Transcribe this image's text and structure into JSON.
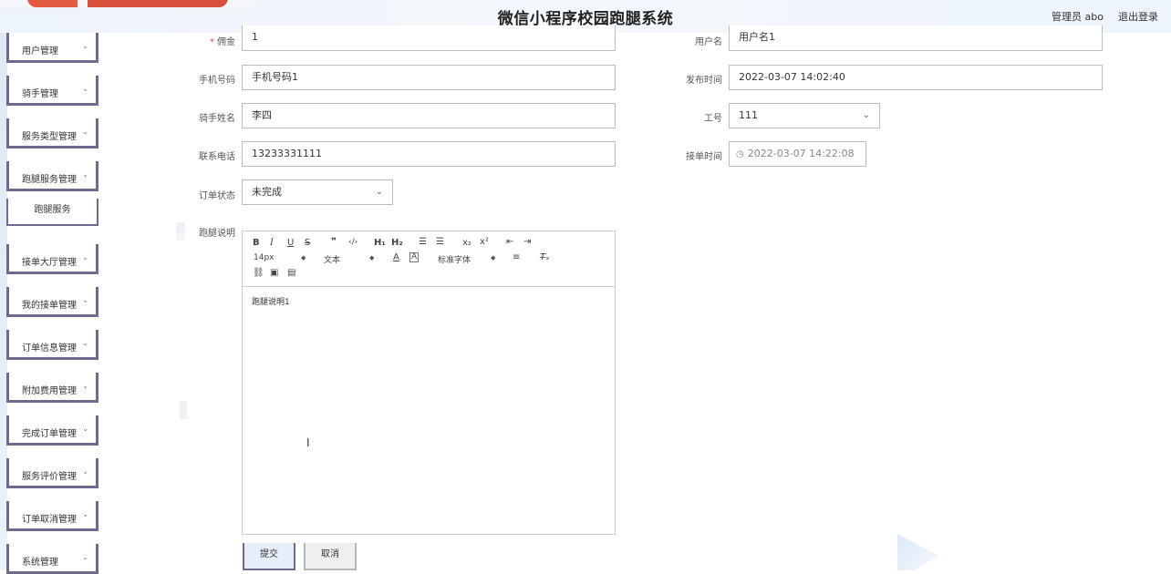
{
  "header": {
    "title": "微信小程序校园跑腿系统",
    "user": "管理员 abo",
    "logout": "退出登录"
  },
  "sidebar": {
    "items": [
      {
        "label": "用户管理"
      },
      {
        "label": "骑手管理"
      },
      {
        "label": "服务类型管理"
      },
      {
        "label": "跑腿服务管理"
      },
      {
        "label": "跑腿服务"
      },
      {
        "label": "接单大厅管理"
      },
      {
        "label": "我的接单管理"
      },
      {
        "label": "订单信息管理"
      },
      {
        "label": "附加费用管理"
      },
      {
        "label": "完成订单管理"
      },
      {
        "label": "服务评价管理"
      },
      {
        "label": "订单取消管理"
      },
      {
        "label": "系统管理"
      }
    ],
    "chevron": "⌄"
  },
  "form": {
    "commission": {
      "required_mark": "*",
      "label": "佣金",
      "value": "1"
    },
    "username": {
      "label": "用户名",
      "value": "用户名1"
    },
    "phone": {
      "label": "手机号码",
      "value": "手机号码1"
    },
    "publish_time": {
      "label": "发布时间",
      "value": "2022-03-07 14:02:40"
    },
    "rider_name": {
      "label": "骑手姓名",
      "value": "李四"
    },
    "work_id": {
      "label": "工号",
      "value": "111"
    },
    "contact_phone": {
      "label": "联系电话",
      "value": "13233331111"
    },
    "accept_time": {
      "label": "接单时间",
      "value": "2022-03-07 14:22:08"
    },
    "order_status": {
      "label": "订单状态",
      "value": "未完成"
    },
    "description": {
      "label": "跑腿说明",
      "value": "跑腿说明1"
    }
  },
  "editor": {
    "font_size": "14px",
    "text_type": "文本",
    "font_family": "标准字体"
  },
  "buttons": {
    "submit": "提交",
    "cancel": "取消"
  }
}
